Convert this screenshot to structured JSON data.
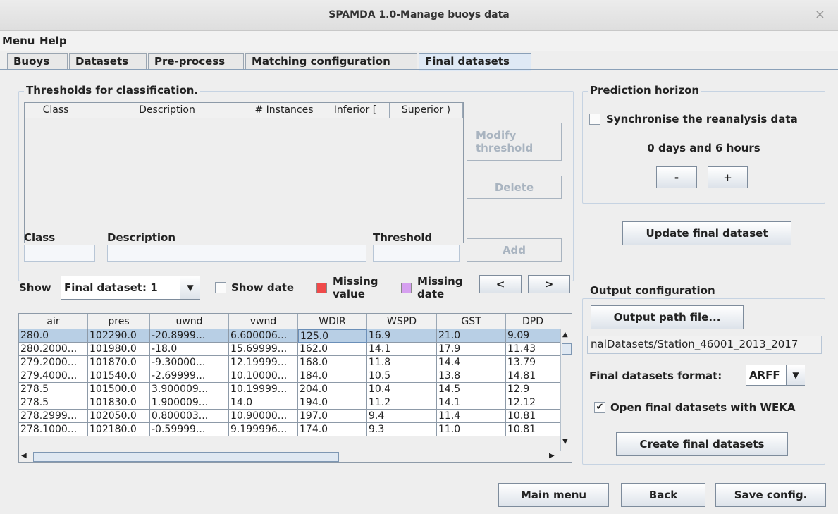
{
  "window": {
    "title": "SPAMDA 1.0-Manage buoys data",
    "close_glyph": "×"
  },
  "menu": [
    "Menu",
    "Help"
  ],
  "tabs": [
    "Buoys",
    "Datasets",
    "Pre-process",
    "Matching configuration",
    "Final datasets"
  ],
  "active_tab": "Final datasets",
  "thresholds": {
    "legend": "Thresholds for classification.",
    "columns": [
      "Class",
      "Description",
      "# Instances",
      "Inferior [",
      "Superior )"
    ],
    "rows": [],
    "modify_label": "Modify threshold",
    "delete_label": "Delete",
    "add_label": "Add",
    "class_label": "Class",
    "description_label": "Description",
    "threshold_label": "Threshold",
    "class_value": "",
    "description_value": "",
    "threshold_value": ""
  },
  "prediction": {
    "legend": "Prediction horizon",
    "sync_label": "Synchronise the reanalysis data",
    "sync_checked": false,
    "horizon_text": "0 days and 6 hours",
    "minus_label": "-",
    "plus_label": "+"
  },
  "update_button": "Update final dataset",
  "show": {
    "label": "Show",
    "selected": "Final dataset: 1",
    "show_date_label": "Show date",
    "show_date_checked": false,
    "missing_value_label": "Missing value",
    "missing_value_color": "#f04a4a",
    "missing_date_label": "Missing date",
    "missing_date_color": "#d6a0f0",
    "prev_label": "<",
    "next_label": ">"
  },
  "data_table": {
    "columns": [
      "air",
      "pres",
      "uwnd",
      "vwnd",
      "WDIR",
      "WSPD",
      "GST",
      "DPD"
    ],
    "rows": [
      [
        "280.0",
        "102290.0",
        "-20.8999...",
        "6.600006...",
        "125.0",
        "16.9",
        "21.0",
        "9.09"
      ],
      [
        "280.2000...",
        "101980.0",
        "-18.0",
        "15.69999...",
        "162.0",
        "14.1",
        "17.9",
        "11.43"
      ],
      [
        "279.2000...",
        "101870.0",
        "-9.30000...",
        "12.19999...",
        "168.0",
        "11.8",
        "14.4",
        "13.79"
      ],
      [
        "279.4000...",
        "101540.0",
        "-2.69999...",
        "10.10000...",
        "184.0",
        "10.5",
        "13.8",
        "14.81"
      ],
      [
        "278.5",
        "101500.0",
        "3.900009...",
        "10.19999...",
        "204.0",
        "10.4",
        "14.5",
        "12.9"
      ],
      [
        "278.5",
        "101830.0",
        "1.900009...",
        "14.0",
        "194.0",
        "11.2",
        "14.1",
        "12.12"
      ],
      [
        "278.2999...",
        "102050.0",
        "0.800003...",
        "10.90000...",
        "197.0",
        "9.4",
        "11.4",
        "10.81"
      ],
      [
        "278.1000...",
        "102180.0",
        "-0.59999...",
        "9.199996...",
        "174.0",
        "9.3",
        "11.0",
        "10.81"
      ]
    ],
    "selected_row": 0
  },
  "output": {
    "legend": "Output configuration",
    "path_button": "Output path file...",
    "path_value": "nalDatasets/Station_46001_2013_2017",
    "format_label": "Final datasets format:",
    "format_value": "ARFF",
    "weka_label": "Open final datasets with WEKA",
    "weka_checked": true,
    "create_button": "Create final datasets"
  },
  "footer": {
    "main_menu": "Main menu",
    "back": "Back",
    "save": "Save config."
  }
}
